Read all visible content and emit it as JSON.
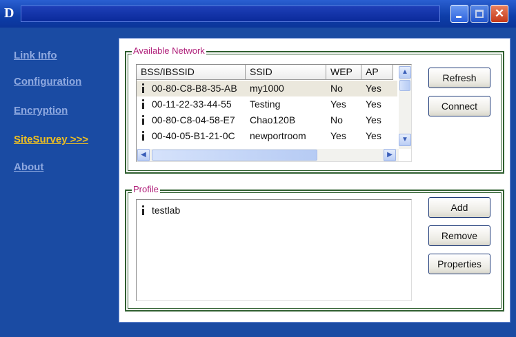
{
  "window": {
    "logo_text": "D",
    "title": "",
    "controls": {
      "minimize_icon": "minimize-icon",
      "maximize_icon": "maximize-icon",
      "close_label": "✕"
    }
  },
  "sidebar": {
    "items": [
      {
        "label": "Link Info",
        "active": false
      },
      {
        "label": "Configuration",
        "active": false
      },
      {
        "label": "Encryption",
        "active": false
      },
      {
        "label": "SiteSurvey >>>",
        "active": true
      },
      {
        "label": "About",
        "active": false
      }
    ]
  },
  "available_network": {
    "title": "Available Network",
    "columns": [
      "BSS/IBSSID",
      "SSID",
      "WEP",
      "AP"
    ],
    "rows": [
      {
        "bssid": "00-80-C8-B8-35-AB",
        "ssid": "my1000",
        "wep": "No",
        "ap": "Yes",
        "selected": true
      },
      {
        "bssid": "00-11-22-33-44-55",
        "ssid": "Testing",
        "wep": "Yes",
        "ap": "Yes",
        "selected": false
      },
      {
        "bssid": "00-80-C8-04-58-E7",
        "ssid": "Chao120B",
        "wep": "No",
        "ap": "Yes",
        "selected": false
      },
      {
        "bssid": "00-40-05-B1-21-0C",
        "ssid": "newportroom",
        "wep": "Yes",
        "ap": "Yes",
        "selected": false
      }
    ],
    "buttons": {
      "refresh": "Refresh",
      "connect": "Connect"
    }
  },
  "profile": {
    "title": "Profile",
    "items": [
      {
        "name": "testlab"
      }
    ],
    "buttons": {
      "add": "Add",
      "remove": "Remove",
      "properties": "Properties"
    }
  },
  "colors": {
    "window_blue": "#1a4ba3",
    "active_nav": "#f0c020",
    "inactive_nav": "#8fa9e0",
    "group_border": "#2f5f2f",
    "group_title": "#b0207a"
  }
}
